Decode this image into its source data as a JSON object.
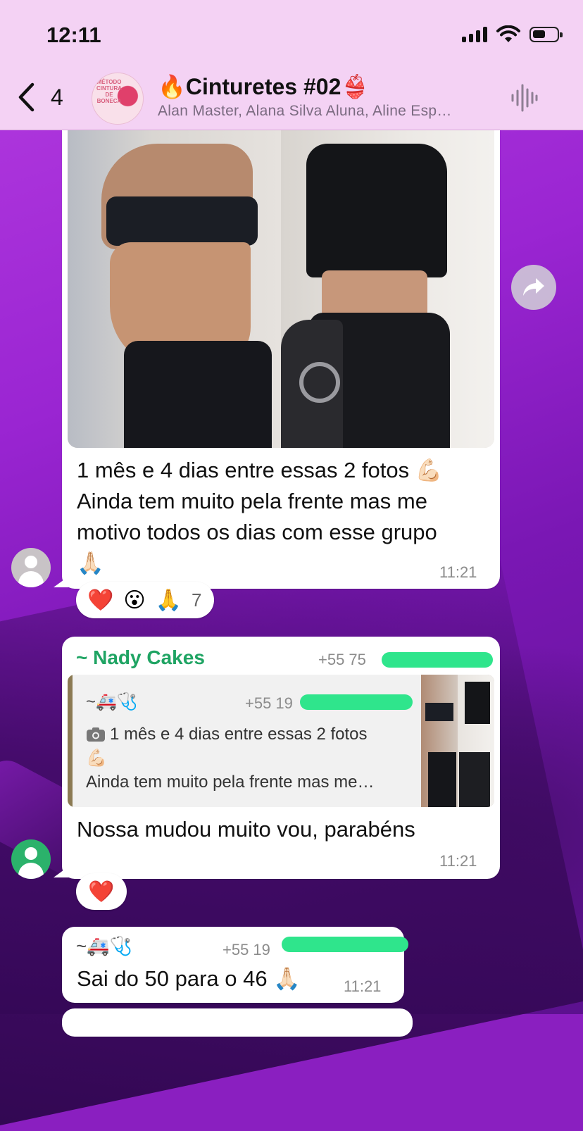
{
  "status_bar": {
    "time": "12:11"
  },
  "header": {
    "back_count": "4",
    "title": "🔥Cinturetes #02👙",
    "subtitle": "Alan Master, Alana Silva Aluna, Aline Esp…",
    "avatar_logo_text": "MÉTODO CINTURA DE BONECA"
  },
  "messages": [
    {
      "caption_line1": "1 mês e 4 dias entre essas 2 fotos 💪🏻",
      "caption_line2": "Ainda tem muito pela frente mas me",
      "caption_line3": "motivo todos os dias com esse grupo",
      "caption_line4": "🙏🏻",
      "time": "11:21",
      "reactions": {
        "heart": "❤️",
        "wow": "😮",
        "pray": "🙏",
        "count": "7"
      }
    },
    {
      "sender": "~ Nady Cakes",
      "sender_phone": "+55 75",
      "quoted_sender": "~🚑🩺",
      "quoted_phone": "+55 19",
      "quoted_line1": "1 mês e 4 dias entre essas 2 fotos",
      "quoted_line2": "💪🏻",
      "quoted_line3": "Ainda tem muito pela frente mas me…",
      "text": "Nossa mudou muito vou, parabéns",
      "time": "11:21",
      "reaction": "❤️"
    },
    {
      "sender": "~🚑🩺",
      "sender_phone": "+55 19",
      "text": "Sai do 50 para o 46 🙏🏻",
      "time": "11:21"
    }
  ],
  "colors": {
    "header_bg": "#f4d2f4",
    "wallpaper": "#9a25d2",
    "sender_green": "#1fa463",
    "redaction": "#2fe58c"
  }
}
